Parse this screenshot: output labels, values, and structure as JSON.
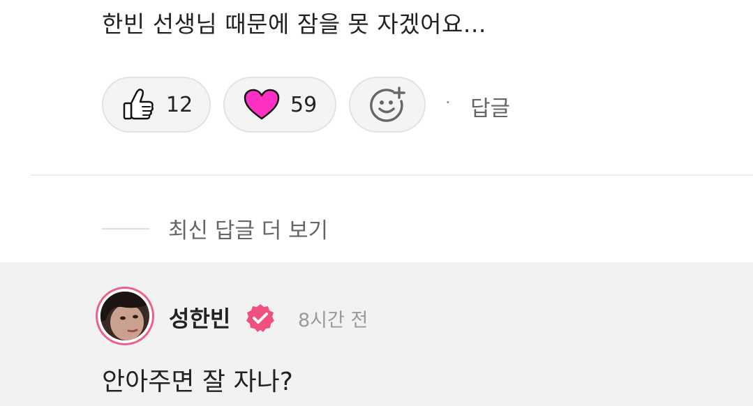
{
  "comment": {
    "text": "한빈 선생님 때문에 잠을 못 자겠어요..."
  },
  "reactions": {
    "like_icon": "thumbs-up-icon",
    "like_count": "12",
    "heart_icon": "heart-icon",
    "heart_count": "59",
    "add_icon": "add-reaction-smiley-icon",
    "separator": "·",
    "reply_label": "답글"
  },
  "replies": {
    "more_label": "최신 답글 더 보기"
  },
  "reply": {
    "author": "성한빈",
    "verified_icon": "verified-badge-icon",
    "time": "8시간 전",
    "text": "안아주면 잘 자나?"
  },
  "colors": {
    "heart": "#ff2fc4",
    "verified": "#f0507d",
    "avatar_ring": "#ee5f8a",
    "reply_background": "#f2f2f2",
    "pill_background": "#f4f4f4"
  }
}
